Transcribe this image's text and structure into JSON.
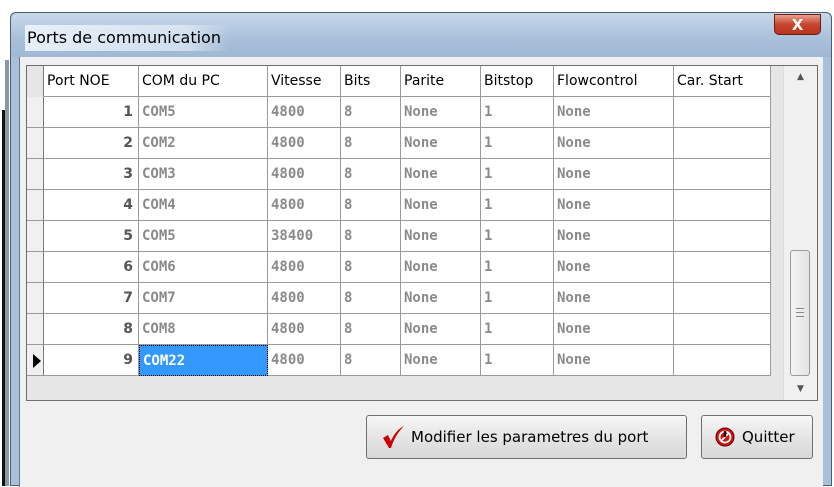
{
  "window": {
    "title": "Ports de communication",
    "close_label": "X"
  },
  "grid": {
    "columns": [
      "Port NOE",
      "COM du PC",
      "Vitesse",
      "Bits",
      "Parite",
      "Bitstop",
      "Flowcontrol",
      "Car. Start"
    ],
    "rows": [
      [
        "1",
        "COM5",
        "4800",
        "8",
        "None",
        "1",
        "None",
        ""
      ],
      [
        "2",
        "COM2",
        "4800",
        "8",
        "None",
        "1",
        "None",
        ""
      ],
      [
        "3",
        "COM3",
        "4800",
        "8",
        "None",
        "1",
        "None",
        ""
      ],
      [
        "4",
        "COM4",
        "4800",
        "8",
        "None",
        "1",
        "None",
        ""
      ],
      [
        "5",
        "COM5",
        "38400",
        "8",
        "None",
        "1",
        "None",
        ""
      ],
      [
        "6",
        "COM6",
        "4800",
        "8",
        "None",
        "1",
        "None",
        ""
      ],
      [
        "7",
        "COM7",
        "4800",
        "8",
        "None",
        "1",
        "None",
        ""
      ],
      [
        "8",
        "COM8",
        "4800",
        "8",
        "None",
        "1",
        "None",
        ""
      ],
      [
        "9",
        "COM22",
        "4800",
        "8",
        "None",
        "1",
        "None",
        ""
      ]
    ],
    "current_row": 9,
    "selected_value": "COM22"
  },
  "buttons": {
    "modify_label": "Modifier les parametres du port",
    "quit_label": "Quitter"
  },
  "icons": {
    "check": "check-icon",
    "quit": "no-entry-icon",
    "scroll_up": "scroll-up-icon",
    "scroll_down": "scroll-down-icon"
  },
  "colors": {
    "selection": "#3399ff",
    "check": "#cc0000"
  }
}
